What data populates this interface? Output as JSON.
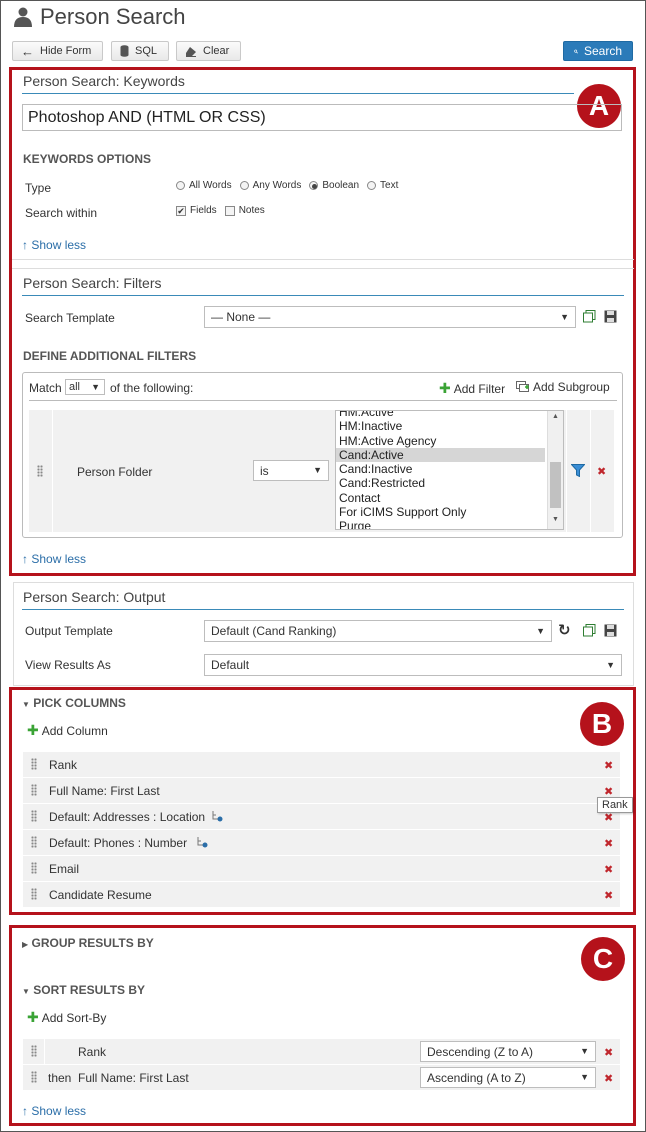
{
  "page": {
    "title": "Person Search"
  },
  "toolbar": {
    "hide_form": "Hide Form",
    "sql": "SQL",
    "clear": "Clear",
    "search": "Search"
  },
  "badges": {
    "a": "A",
    "b": "B",
    "c": "C"
  },
  "keywords": {
    "panel_title": "Person Search: Keywords",
    "query": "Photoshop AND (HTML OR CSS)",
    "options_heading": "KEYWORDS OPTIONS",
    "type_label": "Type",
    "type_options": [
      "All Words",
      "Any Words",
      "Boolean",
      "Text"
    ],
    "type_selected": "Boolean",
    "within_label": "Search within",
    "within_options": [
      {
        "label": "Fields",
        "checked": true
      },
      {
        "label": "Notes",
        "checked": false
      }
    ],
    "show_less": "Show less"
  },
  "filters": {
    "panel_title": "Person Search: Filters",
    "template_label": "Search Template",
    "template_value": "— None —",
    "additional_heading": "DEFINE ADDITIONAL FILTERS",
    "match_prefix": "Match",
    "match_value": "all",
    "match_suffix": "of the following:",
    "add_filter": "Add Filter",
    "add_subgroup": "Add Subgroup",
    "rule_field": "Person Folder",
    "rule_operator": "is",
    "folder_options": [
      "HM:Active",
      "HM:Inactive",
      "HM:Active Agency",
      "Cand:Active",
      "Cand:Inactive",
      "Cand:Restricted",
      "Contact",
      "For iCIMS Support Only",
      "Purge"
    ],
    "folder_selected": "Cand:Active",
    "show_less": "Show less"
  },
  "output": {
    "panel_title": "Person Search: Output",
    "template_label": "Output Template",
    "template_value": "Default (Cand Ranking)",
    "view_label": "View Results As",
    "view_value": "Default"
  },
  "columns": {
    "heading": "PICK COLUMNS",
    "add_column": "Add Column",
    "items": [
      "Rank",
      "Full Name: First Last",
      "Default: Addresses : Location",
      "Default: Phones : Number",
      "Email",
      "Candidate Resume"
    ],
    "tooltip": "Rank"
  },
  "grouping": {
    "group_heading": "GROUP RESULTS BY",
    "sort_heading": "SORT RESULTS BY",
    "add_sort": "Add Sort-By",
    "sorts": [
      {
        "prefix": "",
        "field": "Rank",
        "order": "Descending (Z to A)"
      },
      {
        "prefix": "then",
        "field": "Full Name: First Last",
        "order": "Ascending (A to Z)"
      }
    ],
    "show_less": "Show less"
  }
}
